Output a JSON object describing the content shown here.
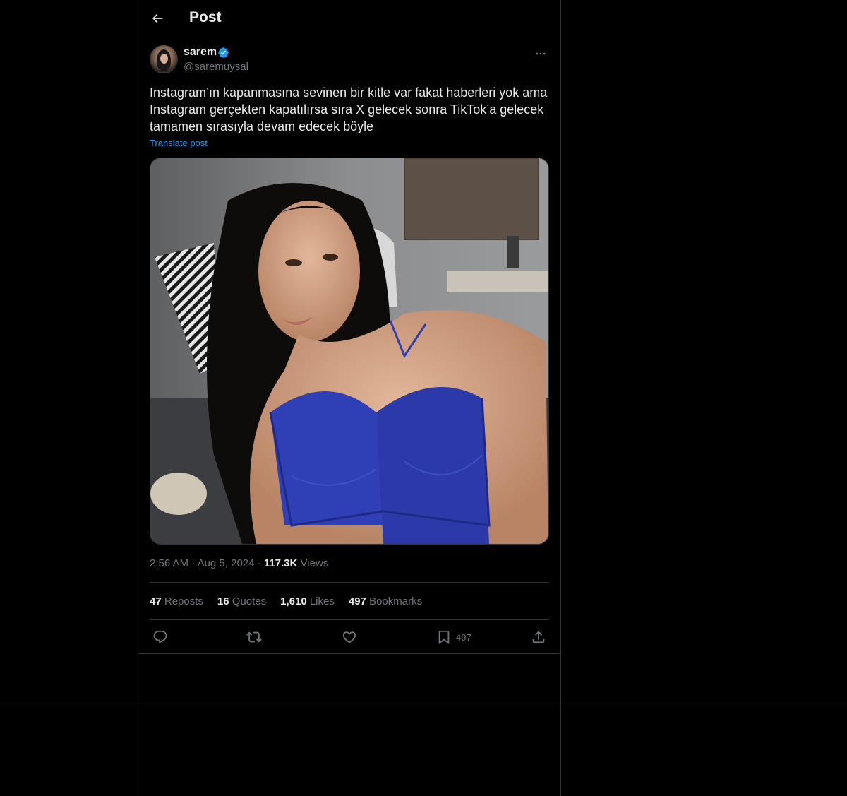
{
  "header": {
    "title": "Post"
  },
  "author": {
    "display_name": "sarem",
    "handle": "@saremuysal",
    "verified": true
  },
  "post": {
    "text": "Instagram’ın kapanmasına sevinen bir kitle var  fakat haberleri yok ama Instagram  gerçekten kapatılırsa sıra X gelecek sonra TikTok’a gelecek tamamen sırasıyla devam edecek böyle",
    "translate_label": "Translate post",
    "time": "2:56 AM",
    "date": "Aug 5, 2024",
    "views_count": "117.3K",
    "views_label": "Views"
  },
  "stats": {
    "reposts_count": "47",
    "reposts_label": "Reposts",
    "quotes_count": "16",
    "quotes_label": "Quotes",
    "likes_count": "1,610",
    "likes_label": "Likes",
    "bookmarks_count": "497",
    "bookmarks_label": "Bookmarks"
  },
  "actions": {
    "bookmark_count": "497"
  },
  "colors": {
    "background": "#000000",
    "text": "#e7e9ea",
    "secondary_text": "#71767b",
    "accent": "#1d9bf0",
    "border": "#2f3336"
  },
  "icons": [
    "back-arrow-icon",
    "verified-badge-icon",
    "more-icon",
    "reply-icon",
    "repost-icon",
    "like-icon",
    "bookmark-icon",
    "share-icon"
  ]
}
